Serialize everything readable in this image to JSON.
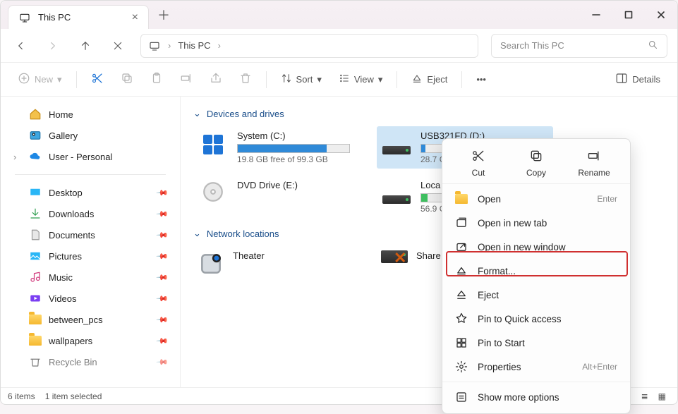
{
  "window": {
    "title": "This PC"
  },
  "nav": {
    "breadcrumb_root": "This PC"
  },
  "search": {
    "placeholder": "Search This PC"
  },
  "toolbar": {
    "new": "New",
    "sort": "Sort",
    "view": "View",
    "eject": "Eject",
    "details": "Details"
  },
  "sidebar": {
    "top": [
      {
        "label": "Home"
      },
      {
        "label": "Gallery"
      },
      {
        "label": "User - Personal"
      }
    ],
    "pinned": [
      {
        "label": "Desktop"
      },
      {
        "label": "Downloads"
      },
      {
        "label": "Documents"
      },
      {
        "label": "Pictures"
      },
      {
        "label": "Music"
      },
      {
        "label": "Videos"
      },
      {
        "label": "between_pcs"
      },
      {
        "label": "wallpapers"
      },
      {
        "label": "Recycle Bin"
      }
    ]
  },
  "sections": {
    "devices": "Devices and drives",
    "network": "Network locations"
  },
  "drives": [
    {
      "name": "System (C:)",
      "sub": "19.8 GB free of 99.3 GB",
      "fill_pct": 80,
      "color": "blue"
    },
    {
      "name": "USB321FD (D:)",
      "sub": "28.7 G",
      "fill_pct": 4,
      "color": "blue",
      "selected": true
    },
    {
      "name": "DVD Drive (E:)",
      "sub": ""
    },
    {
      "name": "Loca",
      "sub": "56.9 G",
      "fill_pct": 6,
      "color": "green"
    }
  ],
  "network": [
    {
      "name": "Theater"
    },
    {
      "name": "Share",
      "broken": true
    }
  ],
  "context": {
    "top": [
      {
        "label": "Cut"
      },
      {
        "label": "Copy"
      },
      {
        "label": "Rename"
      }
    ],
    "items": [
      {
        "label": "Open",
        "hint": "Enter"
      },
      {
        "label": "Open in new tab"
      },
      {
        "label": "Open in new window"
      },
      {
        "label": "Format..."
      },
      {
        "label": "Eject"
      },
      {
        "label": "Pin to Quick access"
      },
      {
        "label": "Pin to Start"
      },
      {
        "label": "Properties",
        "hint": "Alt+Enter"
      },
      {
        "label": "Show more options"
      }
    ]
  },
  "status": {
    "count": "6 items",
    "selected": "1 item selected"
  }
}
